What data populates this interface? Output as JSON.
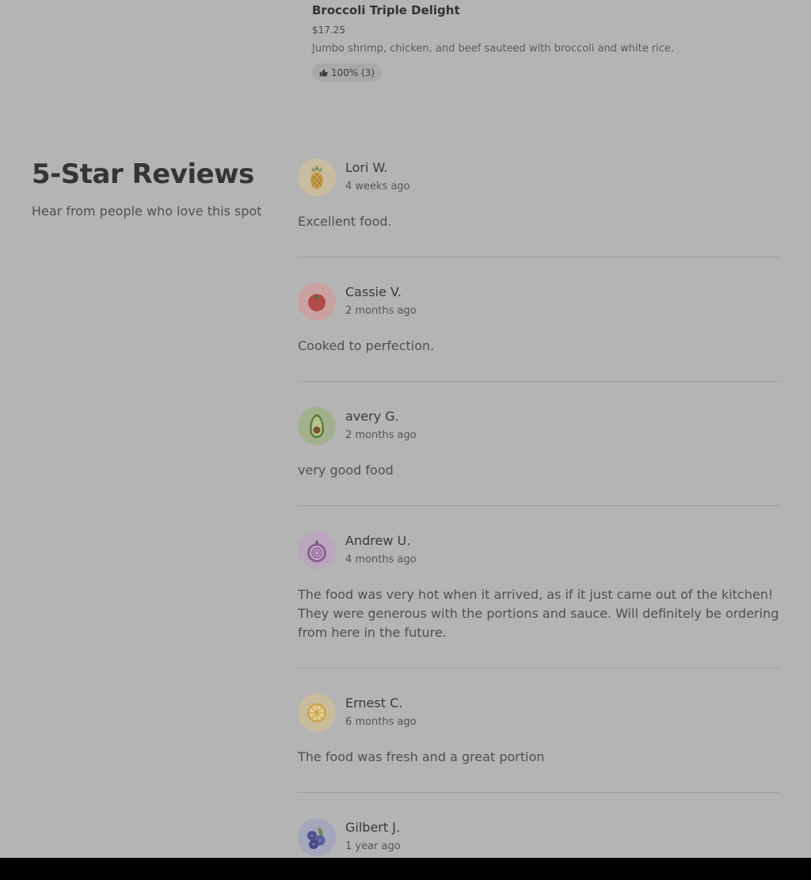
{
  "menu_item": {
    "name": "Broccoli Triple Delight",
    "price": "$17.25",
    "description": "Jumbo shrimp, chicken, and beef sauteed with broccoli and white rice.",
    "rating": "100% (3)",
    "rating_icon": "thumbs-up-icon"
  },
  "section": {
    "title": "5-Star Reviews",
    "subtitle": "Hear from people who love this spot"
  },
  "reviews": [
    {
      "name": "Lori W.",
      "date": "4 weeks ago",
      "text": "Excellent food.",
      "avatar": "pineapple-icon"
    },
    {
      "name": "Cassie V.",
      "date": "2 months ago",
      "text": "Cooked to perfection.",
      "avatar": "tomato-icon"
    },
    {
      "name": "avery G.",
      "date": "2 months ago",
      "text": "very good food",
      "avatar": "avocado-icon"
    },
    {
      "name": "Andrew U.",
      "date": "4 months ago",
      "text": "The food was very hot when it arrived, as if it just came out of the kitchen! They were generous with the portions and sauce. Will definitely be ordering from here in the future.",
      "avatar": "onion-icon"
    },
    {
      "name": "Ernest C.",
      "date": "6 months ago",
      "text": "The food was fresh and a great portion",
      "avatar": "lemon-icon"
    },
    {
      "name": "Gilbert J.",
      "date": "1 year ago",
      "text": "",
      "avatar": "blueberry-icon"
    }
  ],
  "colors": {
    "overlay_background": "#b4b4b4",
    "avatar_pineapple": "#c9bca1",
    "avatar_tomato": "#c9a1a1",
    "avatar_avocado": "#a3b08e",
    "avatar_onion": "#bba7bd",
    "avatar_lemon": "#c9bc9a",
    "avatar_blueberry": "#a4a6bb"
  }
}
